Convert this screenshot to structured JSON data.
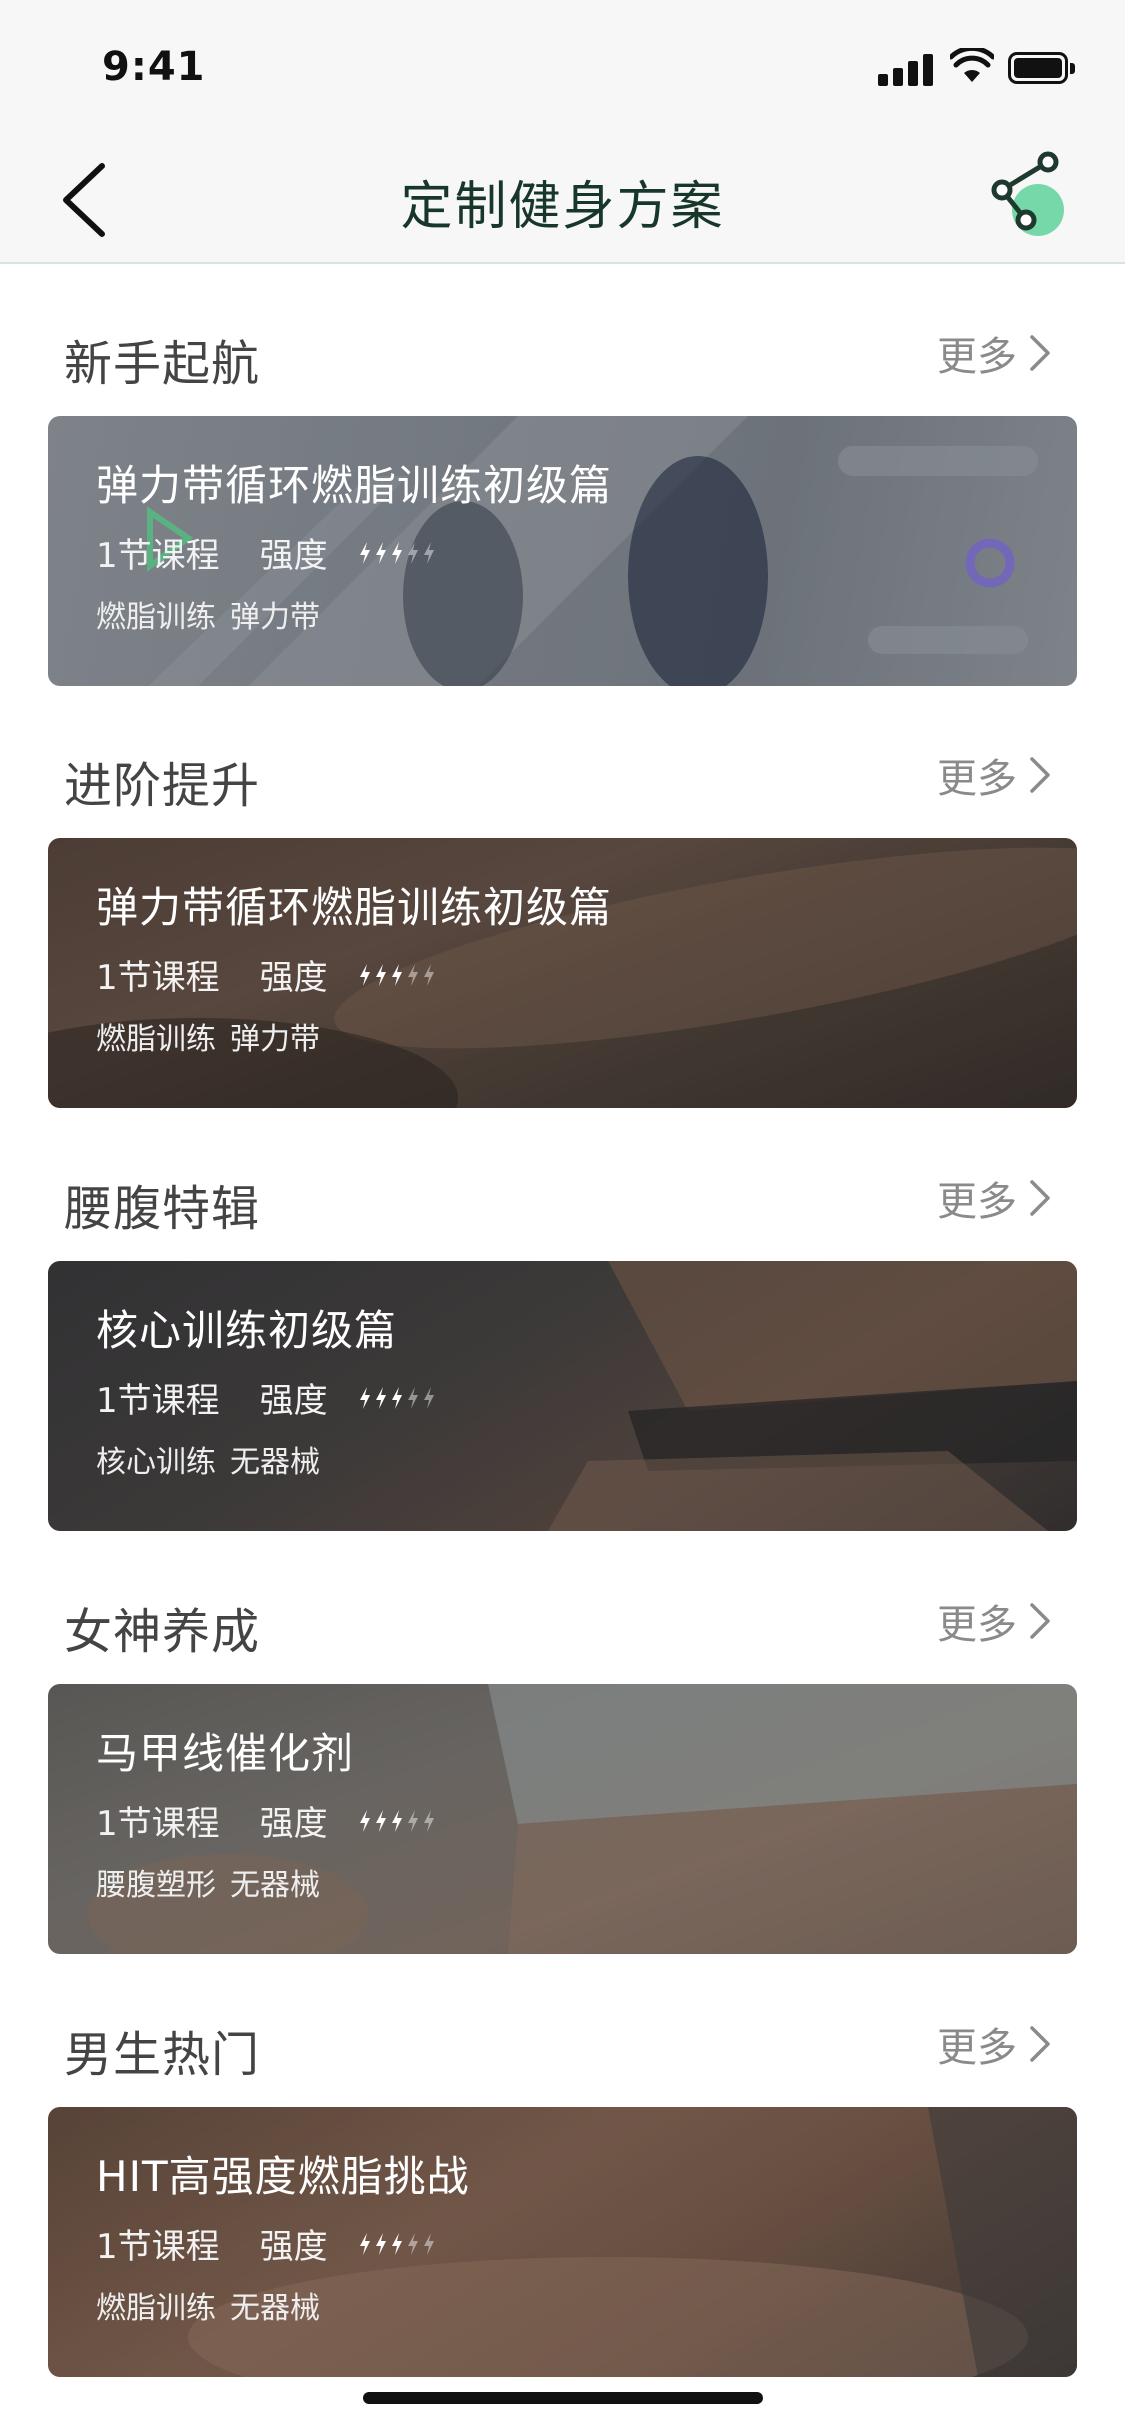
{
  "status_bar": {
    "time": "9:41"
  },
  "header": {
    "title": "定制健身方案"
  },
  "more_label": "更多",
  "sections": [
    {
      "title": "新手起航",
      "card": {
        "title": "弹力带循环燃脂训练初级篇",
        "lessons": "1节课程",
        "intensity_label": "强度",
        "intensity": 3,
        "tags": [
          "燃脂训练",
          "弹力带"
        ]
      }
    },
    {
      "title": "进阶提升",
      "card": {
        "title": "弹力带循环燃脂训练初级篇",
        "lessons": "1节课程",
        "intensity_label": "强度",
        "intensity": 3,
        "tags": [
          "燃脂训练",
          "弹力带"
        ]
      }
    },
    {
      "title": "腰腹特辑",
      "card": {
        "title": "核心训练初级篇",
        "lessons": "1节课程",
        "intensity_label": "强度",
        "intensity": 3,
        "tags": [
          "核心训练",
          "无器械"
        ]
      }
    },
    {
      "title": "女神养成",
      "card": {
        "title": "马甲线催化剂",
        "lessons": "1节课程",
        "intensity_label": "强度",
        "intensity": 3,
        "tags": [
          "腰腹塑形",
          "无器械"
        ]
      }
    },
    {
      "title": "男生热门",
      "card": {
        "title": "HIT高强度燃脂挑战",
        "lessons": "1节课程",
        "intensity_label": "强度",
        "intensity": 3,
        "tags": [
          "燃脂训练",
          "无器械"
        ]
      }
    }
  ],
  "colors": {
    "accent": "#5fd29a",
    "title": "#17372a",
    "muted": "#8a8a8a"
  },
  "icons": {
    "back": "chevron-left-icon",
    "share": "share-icon",
    "more": "chevron-right-icon",
    "intensity": "lightning-bolt-icon"
  }
}
